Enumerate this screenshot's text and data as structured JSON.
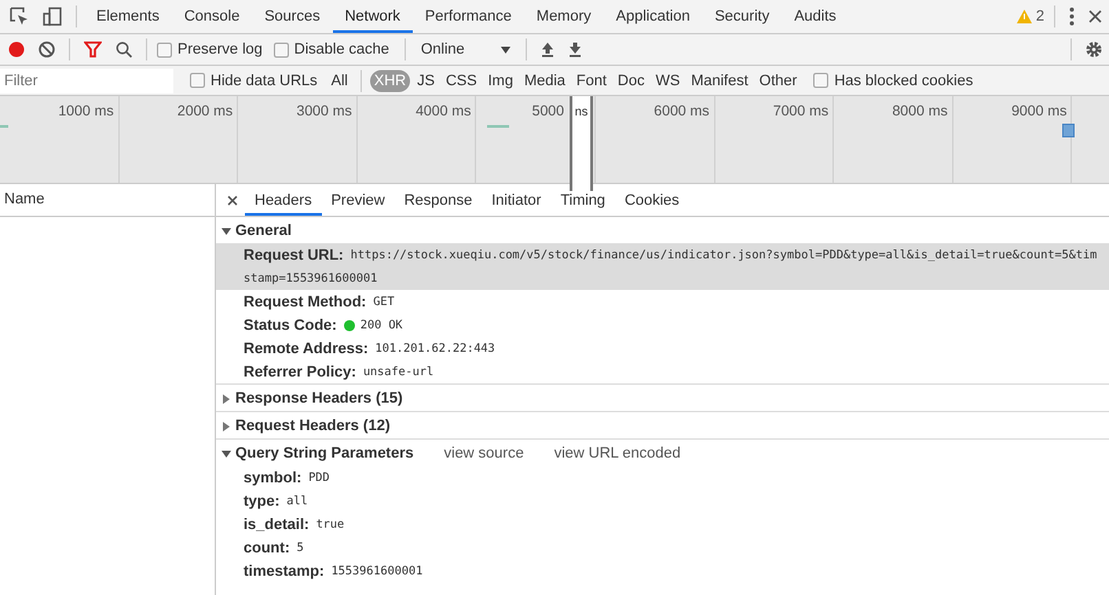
{
  "main_tabs": [
    {
      "label": "Elements",
      "selected": false
    },
    {
      "label": "Console",
      "selected": false
    },
    {
      "label": "Sources",
      "selected": false
    },
    {
      "label": "Network",
      "selected": true
    },
    {
      "label": "Performance",
      "selected": false
    },
    {
      "label": "Memory",
      "selected": false
    },
    {
      "label": "Application",
      "selected": false
    },
    {
      "label": "Security",
      "selected": false
    },
    {
      "label": "Audits",
      "selected": false
    }
  ],
  "warnings": "2",
  "toolbar": {
    "preserve_log": {
      "label": "Preserve log",
      "checked": false
    },
    "disable_cache": {
      "label": "Disable cache",
      "checked": false
    },
    "throttling": "Online"
  },
  "filter": {
    "placeholder": "Filter",
    "hide_data_urls": {
      "label": "Hide data URLs",
      "checked": false
    },
    "types": [
      {
        "label": "All",
        "selected": false
      },
      {
        "label": "XHR",
        "selected": true
      },
      {
        "label": "JS",
        "selected": false
      },
      {
        "label": "CSS",
        "selected": false
      },
      {
        "label": "Img",
        "selected": false
      },
      {
        "label": "Media",
        "selected": false
      },
      {
        "label": "Font",
        "selected": false
      },
      {
        "label": "Doc",
        "selected": false
      },
      {
        "label": "WS",
        "selected": false
      },
      {
        "label": "Manifest",
        "selected": false
      },
      {
        "label": "Other",
        "selected": false
      }
    ],
    "blocked_cookies": {
      "label": "Has blocked cookies",
      "checked": false
    }
  },
  "timeline": {
    "ticks": [
      "1000 ms",
      "2000 ms",
      "3000 ms",
      "4000 ms",
      "5000",
      "6000 ms",
      "7000 ms",
      "8000 ms",
      "9000 ms"
    ],
    "selection_label": "ns"
  },
  "requests": {
    "column": "Name"
  },
  "detail_tabs": [
    {
      "label": "Headers",
      "selected": true
    },
    {
      "label": "Preview",
      "selected": false
    },
    {
      "label": "Response",
      "selected": false
    },
    {
      "label": "Initiator",
      "selected": false
    },
    {
      "label": "Timing",
      "selected": false
    },
    {
      "label": "Cookies",
      "selected": false
    }
  ],
  "sections": [
    {
      "title": "General",
      "expanded": true,
      "rows": [
        {
          "name": "Request URL:",
          "value_lines": [
            "https://stock.xueqiu.com/v5/stock/finance/us/indicator.json?symbol=PDD&type=all&is_detail=true&count=5&tim",
            "stamp=1553961600001"
          ],
          "selected": true
        },
        {
          "name": "Request Method:",
          "value_lines": [
            "GET"
          ],
          "selected": false
        },
        {
          "name": "Status Code:",
          "value_lines": [
            "200 OK"
          ],
          "color": "#1fbf2f",
          "selected": false
        },
        {
          "name": "Remote Address:",
          "value_lines": [
            "101.201.62.22:443"
          ],
          "selected": false
        },
        {
          "name": "Referrer Policy:",
          "value_lines": [
            "unsafe-url"
          ],
          "selected": false
        }
      ]
    },
    {
      "title": "Response Headers (15)",
      "expanded": false
    },
    {
      "title": "Request Headers (12)",
      "expanded": false
    },
    {
      "title": "Query String Parameters",
      "expanded": true,
      "links": [
        "view source",
        "view URL encoded"
      ],
      "rows": [
        {
          "name": "symbol:",
          "value_lines": [
            "PDD"
          ],
          "selected": false
        },
        {
          "name": "type:",
          "value_lines": [
            "all"
          ],
          "selected": false
        },
        {
          "name": "is_detail:",
          "value_lines": [
            "true"
          ],
          "selected": false
        },
        {
          "name": "count:",
          "value_lines": [
            "5"
          ],
          "selected": false
        },
        {
          "name": "timestamp:",
          "value_lines": [
            "1553961600001"
          ],
          "selected": false
        }
      ]
    }
  ]
}
